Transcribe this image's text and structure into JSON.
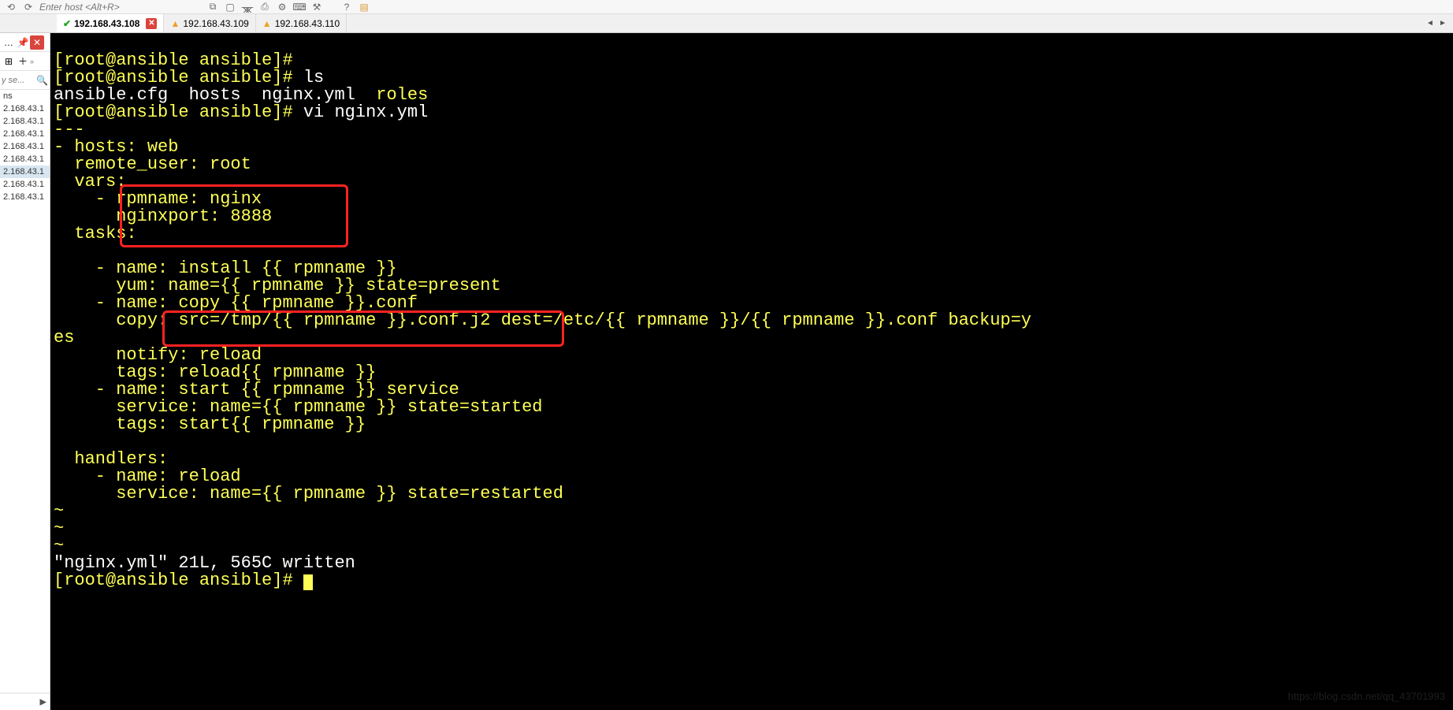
{
  "toolbar": {
    "host_placeholder": "Enter host <Alt+R>"
  },
  "tabs": [
    {
      "label": "192.168.43.108",
      "status": "check",
      "active": true
    },
    {
      "label": "192.168.43.109",
      "status": "warn",
      "active": false
    },
    {
      "label": "192.168.43.110",
      "status": "warn",
      "active": false
    }
  ],
  "sidebar": {
    "search_placeholder": "y se...",
    "header": "ns",
    "items": [
      "2.168.43.1",
      "2.168.43.1",
      "2.168.43.1",
      "2.168.43.1",
      "2.168.43.1",
      "2.168.43.1",
      "2.168.43.1",
      "2.168.43.1"
    ],
    "selected_index": 5
  },
  "terminal": {
    "prompt": "[root@ansible ansible]#",
    "ls_cmd": " ls",
    "ls_out1": "ansible.cfg  hosts  nginx.yml  ",
    "ls_out_roles": "roles",
    "vi_cmd": " vi nginx.yml",
    "line_dashes": "---",
    "line_hosts": "- hosts: web",
    "line_remote": "  remote_user: root",
    "line_vars": "  vars:",
    "line_rpmname": "    - rpmname: nginx",
    "line_nginxport": "      nginxport: 8888",
    "line_tasks": "  tasks:",
    "line_blank": "",
    "line_task1a": "    - name: install {{ rpmname }}",
    "line_task1b": "      yum: name={{ rpmname }} state=present",
    "line_task2a": "    - name: copy {{ rpmname }}.conf",
    "line_task2b": "      copy: src=/tmp/{{ rpmname }}.conf.j2 dest=/etc/{{ rpmname }}/{{ rpmname }}.conf backup=y",
    "line_task2b_wrap": "es",
    "line_task2c": "      notify: reload",
    "line_task2d": "      tags: reload{{ rpmname }}",
    "line_task3a": "    - name: start {{ rpmname }} service",
    "line_task3b": "      service: name={{ rpmname }} state=started",
    "line_task3c": "      tags: start{{ rpmname }}",
    "line_handlers": "  handlers:",
    "line_hand1a": "    - name: reload",
    "line_hand1b": "      service: name={{ rpmname }} state=restarted",
    "tilde": "~",
    "status_line": "\"nginx.yml\" 21L, 565C written"
  },
  "watermark": "https://blog.csdn.net/qq_43701993"
}
